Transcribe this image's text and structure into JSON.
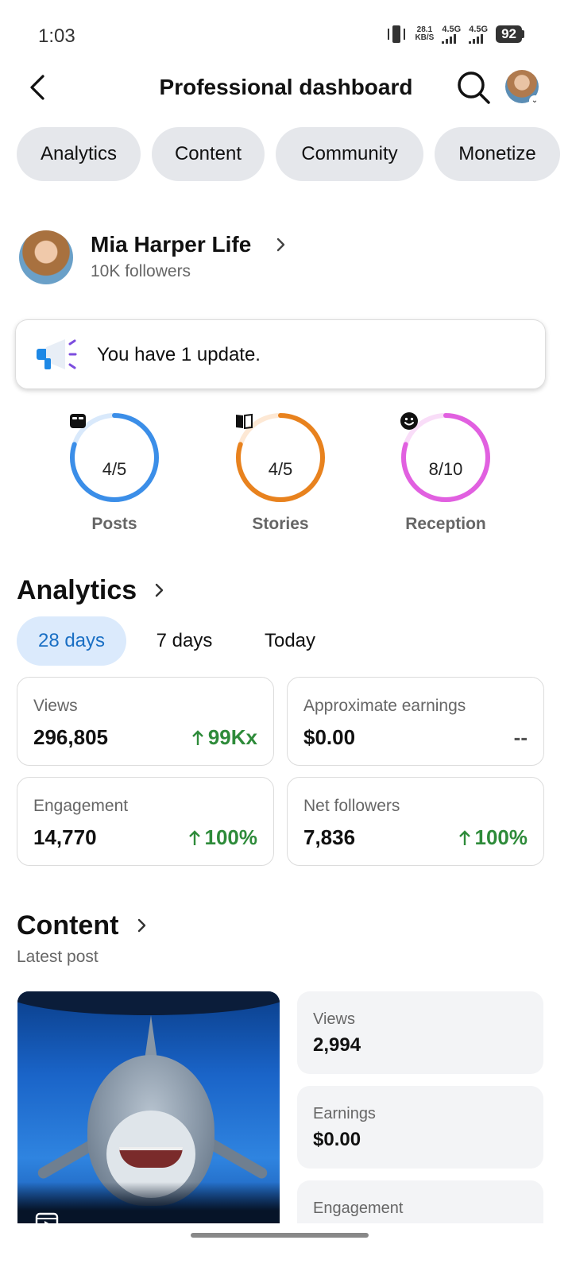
{
  "status": {
    "time": "1:03",
    "speed_value": "28.1",
    "speed_unit": "KB/S",
    "net1": "4.5G",
    "net2": "4.5G",
    "battery": "92"
  },
  "header": {
    "title": "Professional dashboard"
  },
  "chips": [
    "Analytics",
    "Content",
    "Community",
    "Monetize"
  ],
  "profile": {
    "name": "Mia Harper Life",
    "followers": "10K followers"
  },
  "update": {
    "text": "You have 1 update."
  },
  "rings": [
    {
      "label": "Posts",
      "value": "4/5",
      "progress": 0.8,
      "color": "#3b8ee8",
      "track": "#d9e9fb",
      "icon": "post-icon"
    },
    {
      "label": "Stories",
      "value": "4/5",
      "progress": 0.8,
      "color": "#e8821e",
      "track": "#fde8d4",
      "icon": "book-icon"
    },
    {
      "label": "Reception",
      "value": "8/10",
      "progress": 0.8,
      "color": "#e160e0",
      "track": "#f9ddf8",
      "icon": "smile-icon"
    }
  ],
  "analytics": {
    "title": "Analytics",
    "periods": [
      "28 days",
      "7 days",
      "Today"
    ],
    "active_period": "28 days",
    "metrics": [
      {
        "label": "Views",
        "value": "296,805",
        "change": "99Kx",
        "trend": "up"
      },
      {
        "label": "Approximate earnings",
        "value": "$0.00",
        "change": "--",
        "trend": "none"
      },
      {
        "label": "Engagement",
        "value": "14,770",
        "change": "100%",
        "trend": "up"
      },
      {
        "label": "Net followers",
        "value": "7,836",
        "change": "100%",
        "trend": "up"
      }
    ]
  },
  "content": {
    "title": "Content",
    "subtitle": "Latest post",
    "stats": [
      {
        "label": "Views",
        "value": "2,994"
      },
      {
        "label": "Earnings",
        "value": "$0.00"
      },
      {
        "label": "Engagement",
        "value": ""
      }
    ]
  },
  "colors": {
    "accent_blue": "#1a6fc4",
    "positive_green": "#2e8b3a",
    "chip_bg": "#e5e7eb"
  }
}
